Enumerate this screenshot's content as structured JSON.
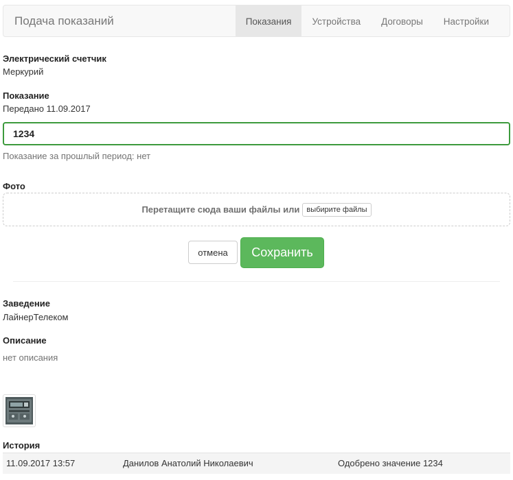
{
  "navbar": {
    "brand": "Подача показаний",
    "tabs": [
      {
        "label": "Показания",
        "active": true
      },
      {
        "label": "Устройства",
        "active": false
      },
      {
        "label": "Договоры",
        "active": false
      },
      {
        "label": "Настройки",
        "active": false
      }
    ]
  },
  "meter": {
    "label": "Электрический счетчик",
    "value": "Меркурий"
  },
  "reading": {
    "label": "Показание",
    "submitted": "Передано 11.09.2017",
    "input_value": "1234",
    "previous_hint": "Показание за прошлый период: нет"
  },
  "photo": {
    "label": "Фото",
    "drop_text": "Перетащите сюда ваши файлы или",
    "choose_label": "выбирите файлы"
  },
  "actions": {
    "cancel_label": "отмена",
    "save_label": "Сохранить"
  },
  "establishment": {
    "label": "Заведение",
    "value": "ЛайнерТелеком"
  },
  "description": {
    "label": "Описание",
    "value": "нет описания"
  },
  "history": {
    "label": "История",
    "rows": [
      {
        "date": "11.09.2017 13:57",
        "user": "Данилов Анатолий Николаевич",
        "action": "Одобрено значение 1234"
      }
    ]
  },
  "colors": {
    "accent_green": "#5cb85c",
    "input_border": "#3c9a3c"
  },
  "icons": {
    "thumbnail": "meter-photo-thumbnail"
  }
}
